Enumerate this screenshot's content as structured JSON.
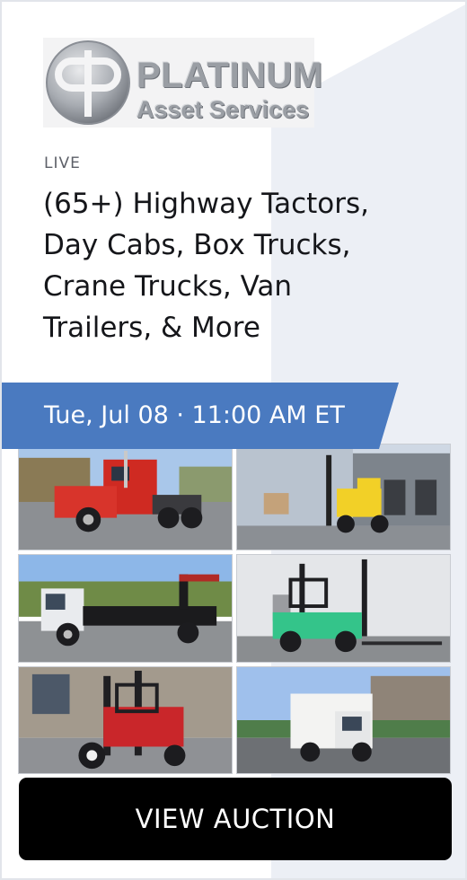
{
  "logo": {
    "name_line1": "PLATINUM",
    "name_line2": "Asset Services",
    "icon": "platinum-pp-monogram-logo"
  },
  "auction": {
    "status": "LIVE",
    "title": "(65+) Highway Tactors, Day Cabs, Box Trucks, Crane Trucks, Van Trailers, & More",
    "date": "Tue, Jul 08 · 11:00 AM ET"
  },
  "photos": [
    {
      "subject": "red semi truck tractor"
    },
    {
      "subject": "yellow forklift"
    },
    {
      "subject": "white flatbed crane truck"
    },
    {
      "subject": "green forklift"
    },
    {
      "subject": "red truck-mounted forklift"
    },
    {
      "subject": "white box truck"
    }
  ],
  "cta": {
    "label": "VIEW AUCTION"
  },
  "colors": {
    "banner": "#4a7ac0",
    "background_wedge": "#eceff5",
    "cta_background": "#000000",
    "title_text": "#15161a"
  }
}
